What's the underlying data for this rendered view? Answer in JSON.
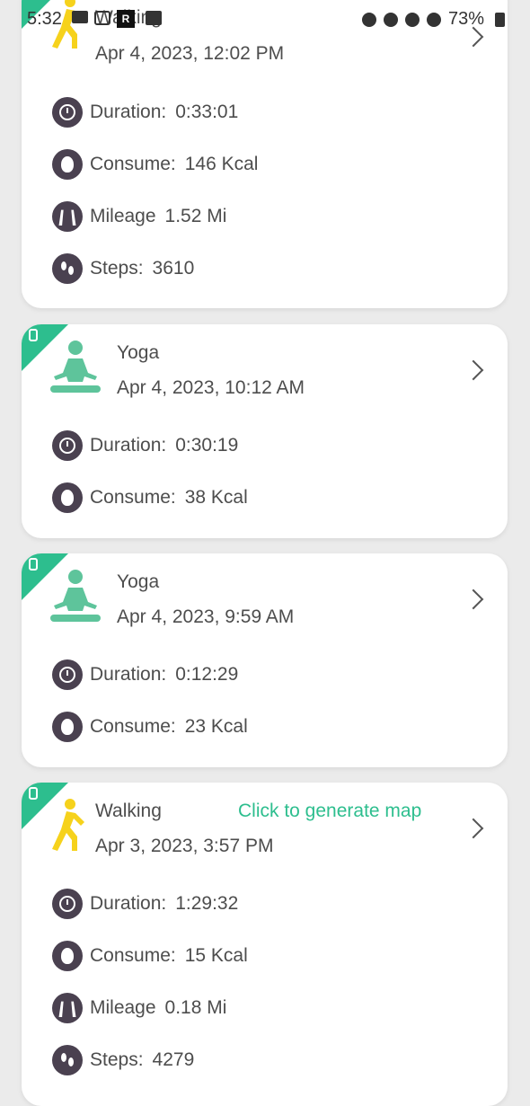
{
  "status_bar": {
    "time": "5:32",
    "battery": "73%"
  },
  "cards": [
    {
      "activity": "Walking",
      "date": "Apr 4, 2023, 12:02 PM",
      "stats": {
        "duration_label": "Duration:",
        "duration": "0:33:01",
        "consume_label": "Consume:",
        "consume": "146 Kcal",
        "mileage_label": "Mileage",
        "mileage": "1.52 Mi",
        "steps_label": "Steps:",
        "steps": "3610"
      }
    },
    {
      "activity": "Yoga",
      "date": "Apr 4, 2023, 10:12 AM",
      "stats": {
        "duration_label": "Duration:",
        "duration": "0:30:19",
        "consume_label": "Consume:",
        "consume": "38 Kcal"
      }
    },
    {
      "activity": "Yoga",
      "date": "Apr 4, 2023, 9:59 AM",
      "stats": {
        "duration_label": "Duration:",
        "duration": "0:12:29",
        "consume_label": "Consume:",
        "consume": "23 Kcal"
      }
    },
    {
      "activity": "Walking",
      "date": "Apr 3, 2023, 3:57 PM",
      "map_link": "Click to generate map",
      "stats": {
        "duration_label": "Duration:",
        "duration": "1:29:32",
        "consume_label": "Consume:",
        "consume": "15 Kcal",
        "mileage_label": "Mileage",
        "mileage": "0.18 Mi",
        "steps_label": "Steps:",
        "steps": "4279"
      }
    }
  ],
  "colors": {
    "accent": "#2dbe8e",
    "walker": "#f6d21c",
    "icon_bg": "#4a4150",
    "text": "#4d4d4d"
  }
}
